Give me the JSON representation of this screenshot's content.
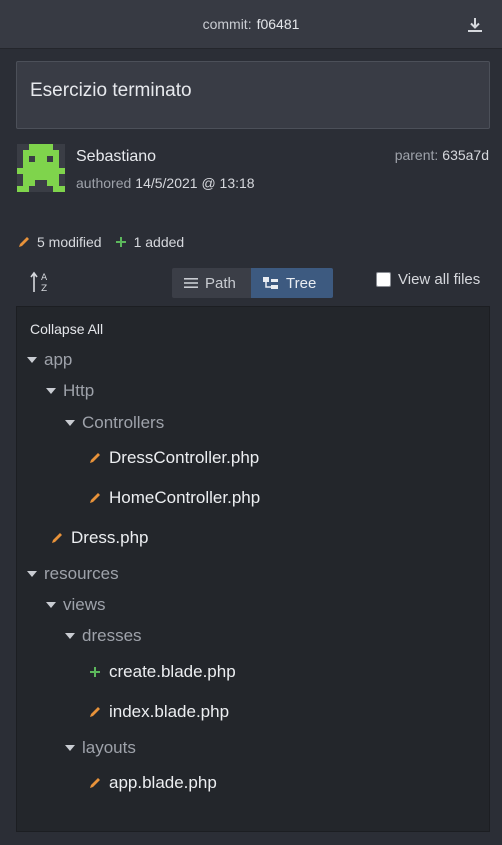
{
  "header": {
    "commit_label": "commit:",
    "commit_sha": "f06481"
  },
  "message": "Esercizio terminato",
  "author": {
    "name": "Sebastiano",
    "authored_label": "authored",
    "date": "14/5/2021 @ 13:18",
    "parent_label": "parent:",
    "parent_sha": "635a7d"
  },
  "stats": {
    "modified": "5 modified",
    "added": "1 added"
  },
  "view_toggle": {
    "path_label": "Path",
    "tree_label": "Tree",
    "selected": "Tree"
  },
  "view_all_files": {
    "label": "View all files",
    "checked": false
  },
  "tree": {
    "collapse_all": "Collapse All",
    "nodes": [
      {
        "label": "app",
        "type": "folder"
      },
      {
        "label": "Http",
        "type": "folder"
      },
      {
        "label": "Controllers",
        "type": "folder"
      },
      {
        "label": "DressController.php",
        "type": "file",
        "status": "modified"
      },
      {
        "label": "HomeController.php",
        "type": "file",
        "status": "modified"
      },
      {
        "label": "Dress.php",
        "type": "file",
        "status": "modified"
      },
      {
        "label": "resources",
        "type": "folder"
      },
      {
        "label": "views",
        "type": "folder"
      },
      {
        "label": "dresses",
        "type": "folder"
      },
      {
        "label": "create.blade.php",
        "type": "file",
        "status": "added"
      },
      {
        "label": "index.blade.php",
        "type": "file",
        "status": "modified"
      },
      {
        "label": "layouts",
        "type": "folder"
      },
      {
        "label": "app.blade.php",
        "type": "file",
        "status": "modified"
      }
    ]
  },
  "colors": {
    "modified": "#e8923a",
    "added": "#5cb85c",
    "selected_tab": "#3d5a80",
    "avatar": "#7fd44c"
  },
  "icons": {
    "download": "download-icon",
    "sort": "sort-az-icon",
    "path": "list-icon",
    "tree": "tree-icon",
    "modified": "pencil-icon",
    "added": "plus-icon"
  }
}
